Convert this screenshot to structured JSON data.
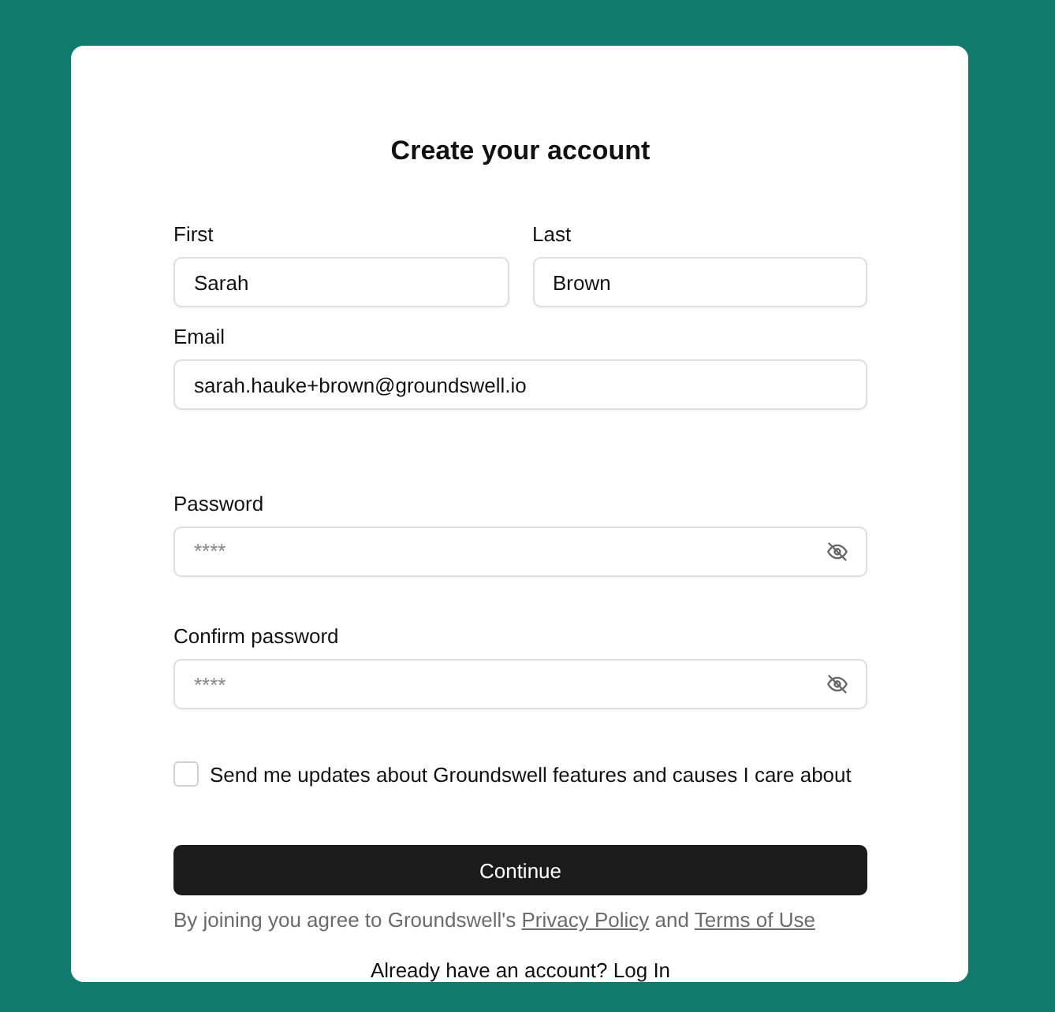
{
  "title": "Create your account",
  "name_fields": [
    {
      "label": "First",
      "value": "Sarah"
    },
    {
      "label": "Last",
      "value": "Brown"
    }
  ],
  "email": {
    "label": "Email",
    "value": "sarah.hauke+brown@groundswell.io"
  },
  "password_fields": [
    {
      "label": "Password",
      "placeholder": "****"
    },
    {
      "label": "Confirm password",
      "placeholder": "****"
    }
  ],
  "updates_checkbox": {
    "label": "Send me updates about Groundswell features and causes I care about",
    "checked": false
  },
  "submit_button": "Continue",
  "legal": [
    {
      "kind": "text",
      "text": "By joining you agree to Groundswell's"
    },
    {
      "kind": "link",
      "text": "Privacy Policy"
    },
    {
      "kind": "text",
      "text": "and"
    },
    {
      "kind": "link",
      "text": "Terms of Use"
    }
  ],
  "login_prompt": {
    "text": "Already have an account?",
    "link": "Log In"
  }
}
